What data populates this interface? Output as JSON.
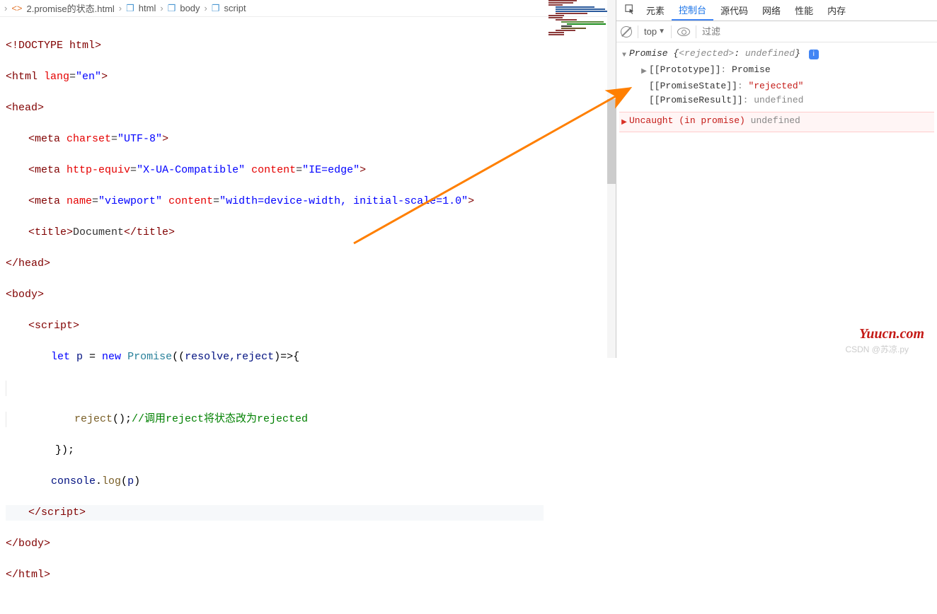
{
  "breadcrumb": {
    "file": "2.promise的状态.html",
    "p1": "html",
    "p2": "body",
    "p3": "script"
  },
  "code": {
    "l1": {
      "doctype": "<!DOCTYPE",
      "rest": " html>"
    },
    "l2": {
      "open": "<html",
      "attr": " lang",
      "eq": "=",
      "val": "\"en\"",
      "close": ">"
    },
    "l3": "<head>",
    "l4": {
      "open": "<meta",
      "attr": " charset",
      "eq": "=",
      "val": "\"UTF-8\"",
      "close": ">"
    },
    "l5": {
      "open": "<meta",
      "a1": " http-equiv",
      "v1": "\"X-UA-Compatible\"",
      "a2": " content",
      "v2": "\"IE=edge\"",
      "close": ">"
    },
    "l6": {
      "open": "<meta",
      "a1": " name",
      "v1": "\"viewport\"",
      "a2": " content",
      "v2": "\"width=device-width, initial-scale=1.0\"",
      "close": ">"
    },
    "l7": {
      "open": "<title>",
      "txt": "Document",
      "close": "</title>"
    },
    "l8": "</head>",
    "l9": "<body>",
    "l10": "<script>",
    "l11": {
      "let": "let",
      "p": " p ",
      "eq": "= ",
      "new": "new",
      "promise": " Promise",
      "paren": "((",
      "args": "resolve,reject",
      "arrow": ")=>",
      "brace": "{"
    },
    "l13": {
      "fn": "reject",
      "call": "();",
      "comment": "//调用reject将状态改为rejected"
    },
    "l14": "});",
    "l15": {
      "obj": "console",
      "dot": ".",
      "fn": "log",
      "open": "(",
      "arg": "p",
      "close": ")"
    },
    "l16": "</script>",
    "l17": "</body>",
    "l18": "</html>"
  },
  "devtools": {
    "tabs": [
      "元素",
      "控制台",
      "源代码",
      "网络",
      "性能",
      "内存"
    ],
    "active_tab": 1,
    "top": "top",
    "filter_placeholder": "过滤",
    "promise_head1": "Promise {",
    "promise_rej": "<rejected>",
    "promise_head2": ": ",
    "promise_undef": "undefined",
    "promise_head3": "}",
    "proto_k": "[[Prototype]]",
    "proto_v": "Promise",
    "state_k": "[[PromiseState]]",
    "state_v": "\"rejected\"",
    "result_k": "[[PromiseResult]]",
    "result_v": "undefined",
    "err": "Uncaught (in promise)",
    "err_v": "undefined"
  },
  "watermark": "Yuucn.com",
  "csdn": "CSDN @苏凉.py"
}
